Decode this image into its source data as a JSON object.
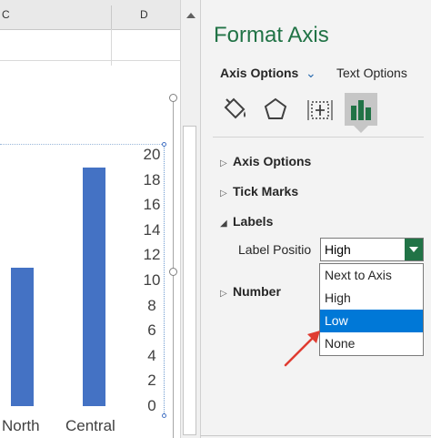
{
  "spreadsheet": {
    "column_headers": [
      "C",
      "D"
    ]
  },
  "chart_data": {
    "type": "bar",
    "categories": [
      "North",
      "Central"
    ],
    "values": [
      11,
      19
    ],
    "ylim": [
      0,
      20
    ],
    "y_ticks": [
      "0",
      "2",
      "4",
      "6",
      "8",
      "10",
      "12",
      "14",
      "16",
      "18",
      "20"
    ],
    "axis_position": "right",
    "bar_color": "#4472c4"
  },
  "pane": {
    "title": "Format Axis",
    "tab_axis_options": "Axis Options",
    "tab_text_options": "Text Options",
    "icons": [
      "fill-line-icon",
      "effects-pentagon-icon",
      "size-properties-icon",
      "axis-options-bars-icon"
    ],
    "sections": {
      "axis_options": "Axis Options",
      "tick_marks": "Tick Marks",
      "labels": "Labels",
      "number": "Number"
    },
    "label_position_label": "Label Positio",
    "dropdown_value": "High",
    "dropdown_options": [
      "Next to Axis",
      "High",
      "Low",
      "None"
    ],
    "dropdown_selected": "Low",
    "accent_color": "#217346",
    "selection_color": "#0078d7"
  }
}
